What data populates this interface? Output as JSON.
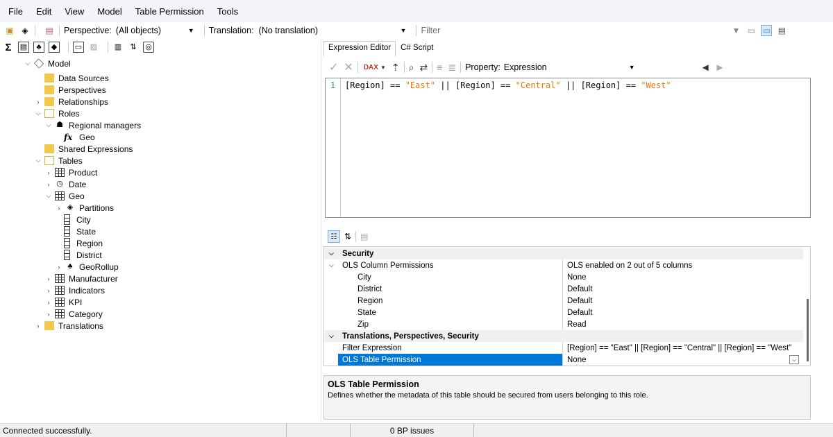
{
  "menu": [
    "File",
    "Edit",
    "View",
    "Model",
    "Table Permission",
    "Tools"
  ],
  "toolbar": {
    "perspective_label": "Perspective:",
    "perspective_value": "(All objects)",
    "translation_label": "Translation:",
    "translation_value": "(No translation)",
    "filter_placeholder": "Filter"
  },
  "tree": {
    "model": "Model",
    "data_sources": "Data Sources",
    "perspectives": "Perspectives",
    "relationships": "Relationships",
    "roles": "Roles",
    "regional_managers": "Regional managers",
    "geo_expr": "Geo",
    "fx": "fx",
    "shared_expressions": "Shared Expressions",
    "tables": "Tables",
    "product": "Product",
    "date": "Date",
    "geo": "Geo",
    "partitions": "Partitions",
    "city": "City",
    "state": "State",
    "region": "Region",
    "district": "District",
    "georollup": "GeoRollup",
    "manufacturer": "Manufacturer",
    "indicators": "Indicators",
    "kpi": "KPI",
    "category": "Category",
    "translations": "Translations"
  },
  "tabs": [
    "Expression Editor",
    "C# Script"
  ],
  "editor_toolbar": {
    "property_label": "Property:",
    "property_value": "Expression"
  },
  "editor": {
    "line_number": "1",
    "tok1": "[Region] == ",
    "str1": "\"East\"",
    "tok2": " || [Region] == ",
    "str2": "\"Central\"",
    "tok3": " || [Region] == ",
    "str3": "\"West\""
  },
  "properties": {
    "security": "Security",
    "ols_col_perm": "OLS Column Permissions",
    "ols_col_perm_value": "OLS enabled on 2 out of 5 columns",
    "rows": [
      {
        "name": "City",
        "value": "None"
      },
      {
        "name": "District",
        "value": "Default"
      },
      {
        "name": "Region",
        "value": "Default"
      },
      {
        "name": "State",
        "value": "Default"
      },
      {
        "name": "Zip",
        "value": "Read"
      }
    ],
    "tps": "Translations, Perspectives, Security",
    "filter_expression": "Filter Expression",
    "filter_expression_value": "[Region] == \"East\" || [Region] == \"Central\" || [Region] == \"West\"",
    "ols_table_perm": "OLS Table Permission",
    "ols_table_perm_value": "None"
  },
  "description": {
    "title": "OLS Table Permission",
    "text": "Defines whether the metadata of this table should be secured from users belonging to this role."
  },
  "status": {
    "left": "Connected successfully.",
    "bp": "0 BP issues"
  },
  "colors": {
    "selection": "#0078d7",
    "string": "#e8770a",
    "line_number": "#2b91af"
  }
}
